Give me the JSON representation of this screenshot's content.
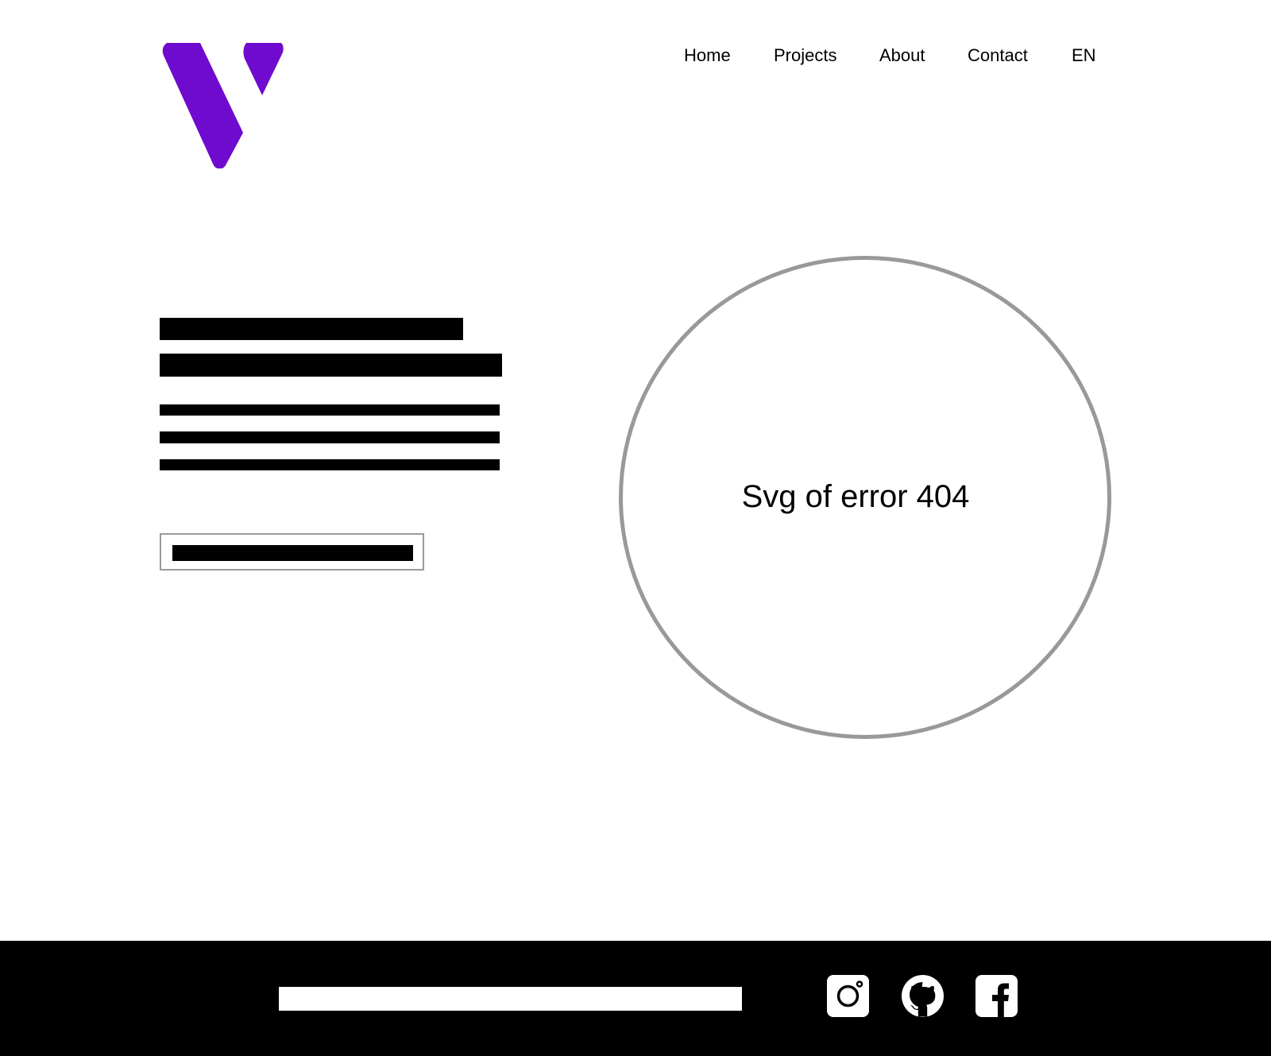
{
  "header": {
    "logo_icon": "v-logo-icon",
    "nav": {
      "home": "Home",
      "projects": "Projects",
      "about": "About",
      "contact": "Contact",
      "language": "EN"
    }
  },
  "main": {
    "illustration_label": "Svg of error 404"
  },
  "footer": {
    "social_icons": [
      "instagram-icon",
      "github-icon",
      "facebook-icon"
    ]
  },
  "colors": {
    "brand": "#6E0BCF",
    "outline": "#999999",
    "text": "#000000",
    "background": "#FFFFFF",
    "footer": "#000000"
  }
}
